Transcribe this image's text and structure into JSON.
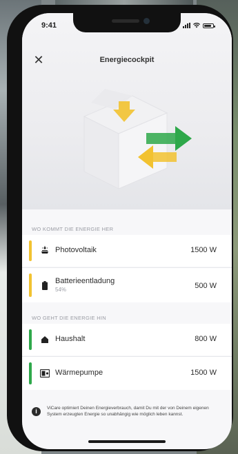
{
  "status": {
    "time": "9:41"
  },
  "header": {
    "title": "Energiecockpit",
    "close_icon": "close-icon"
  },
  "sources": {
    "label": "WO KOMMT DIE ENERGIE HER",
    "items": [
      {
        "name": "Photovoltaik",
        "sub": "",
        "value": "1500 W",
        "icon": "solar-panel-icon",
        "color": "#f2c230"
      },
      {
        "name": "Batterieentladung",
        "sub": "54%",
        "value": "500 W",
        "icon": "battery-icon",
        "color": "#f2c230"
      }
    ]
  },
  "sinks": {
    "label": "WO GEHT DIE ENERGIE HIN",
    "items": [
      {
        "name": "Haushalt",
        "sub": "",
        "value": "800 W",
        "icon": "house-icon",
        "color": "#2ea84a"
      },
      {
        "name": "Wärmepumpe",
        "sub": "",
        "value": "1500 W",
        "icon": "heat-pump-icon",
        "color": "#2ea84a"
      }
    ]
  },
  "info": {
    "icon": "info-icon",
    "text": "ViCare optimiert Deinen Energieverbrauch, damit Du mit der von Deinem eigenen System erzeugten Energie so unabhängig wie möglich leben kannst."
  },
  "colors": {
    "accent_yellow": "#f2c230",
    "accent_green": "#2ea84a"
  }
}
